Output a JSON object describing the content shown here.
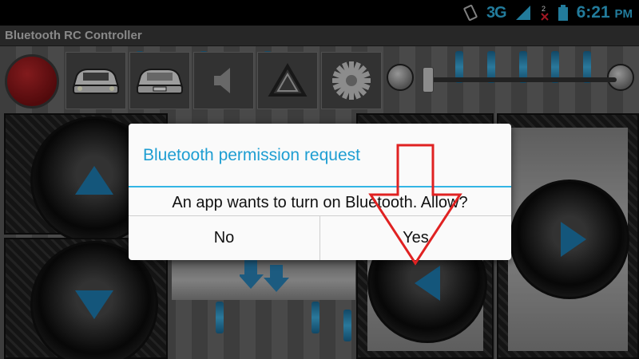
{
  "status_bar": {
    "network": "3G",
    "time": "6:21",
    "period": "PM",
    "accent": "#33b5e5"
  },
  "app": {
    "title": "Bluetooth RC Controller",
    "toolbar": [
      {
        "icon": "stop-light-icon"
      },
      {
        "icon": "front-lights-icon"
      },
      {
        "icon": "back-lights-icon"
      },
      {
        "icon": "horn-icon"
      },
      {
        "icon": "hazard-icon"
      },
      {
        "icon": "settings-icon"
      }
    ],
    "speed_slider": {
      "value": 0.0
    }
  },
  "dialog": {
    "title": "Bluetooth permission request",
    "message": "An app wants to turn on Bluetooth. Allow?",
    "no_label": "No",
    "yes_label": "Yes",
    "accent": "#33b5e5"
  }
}
